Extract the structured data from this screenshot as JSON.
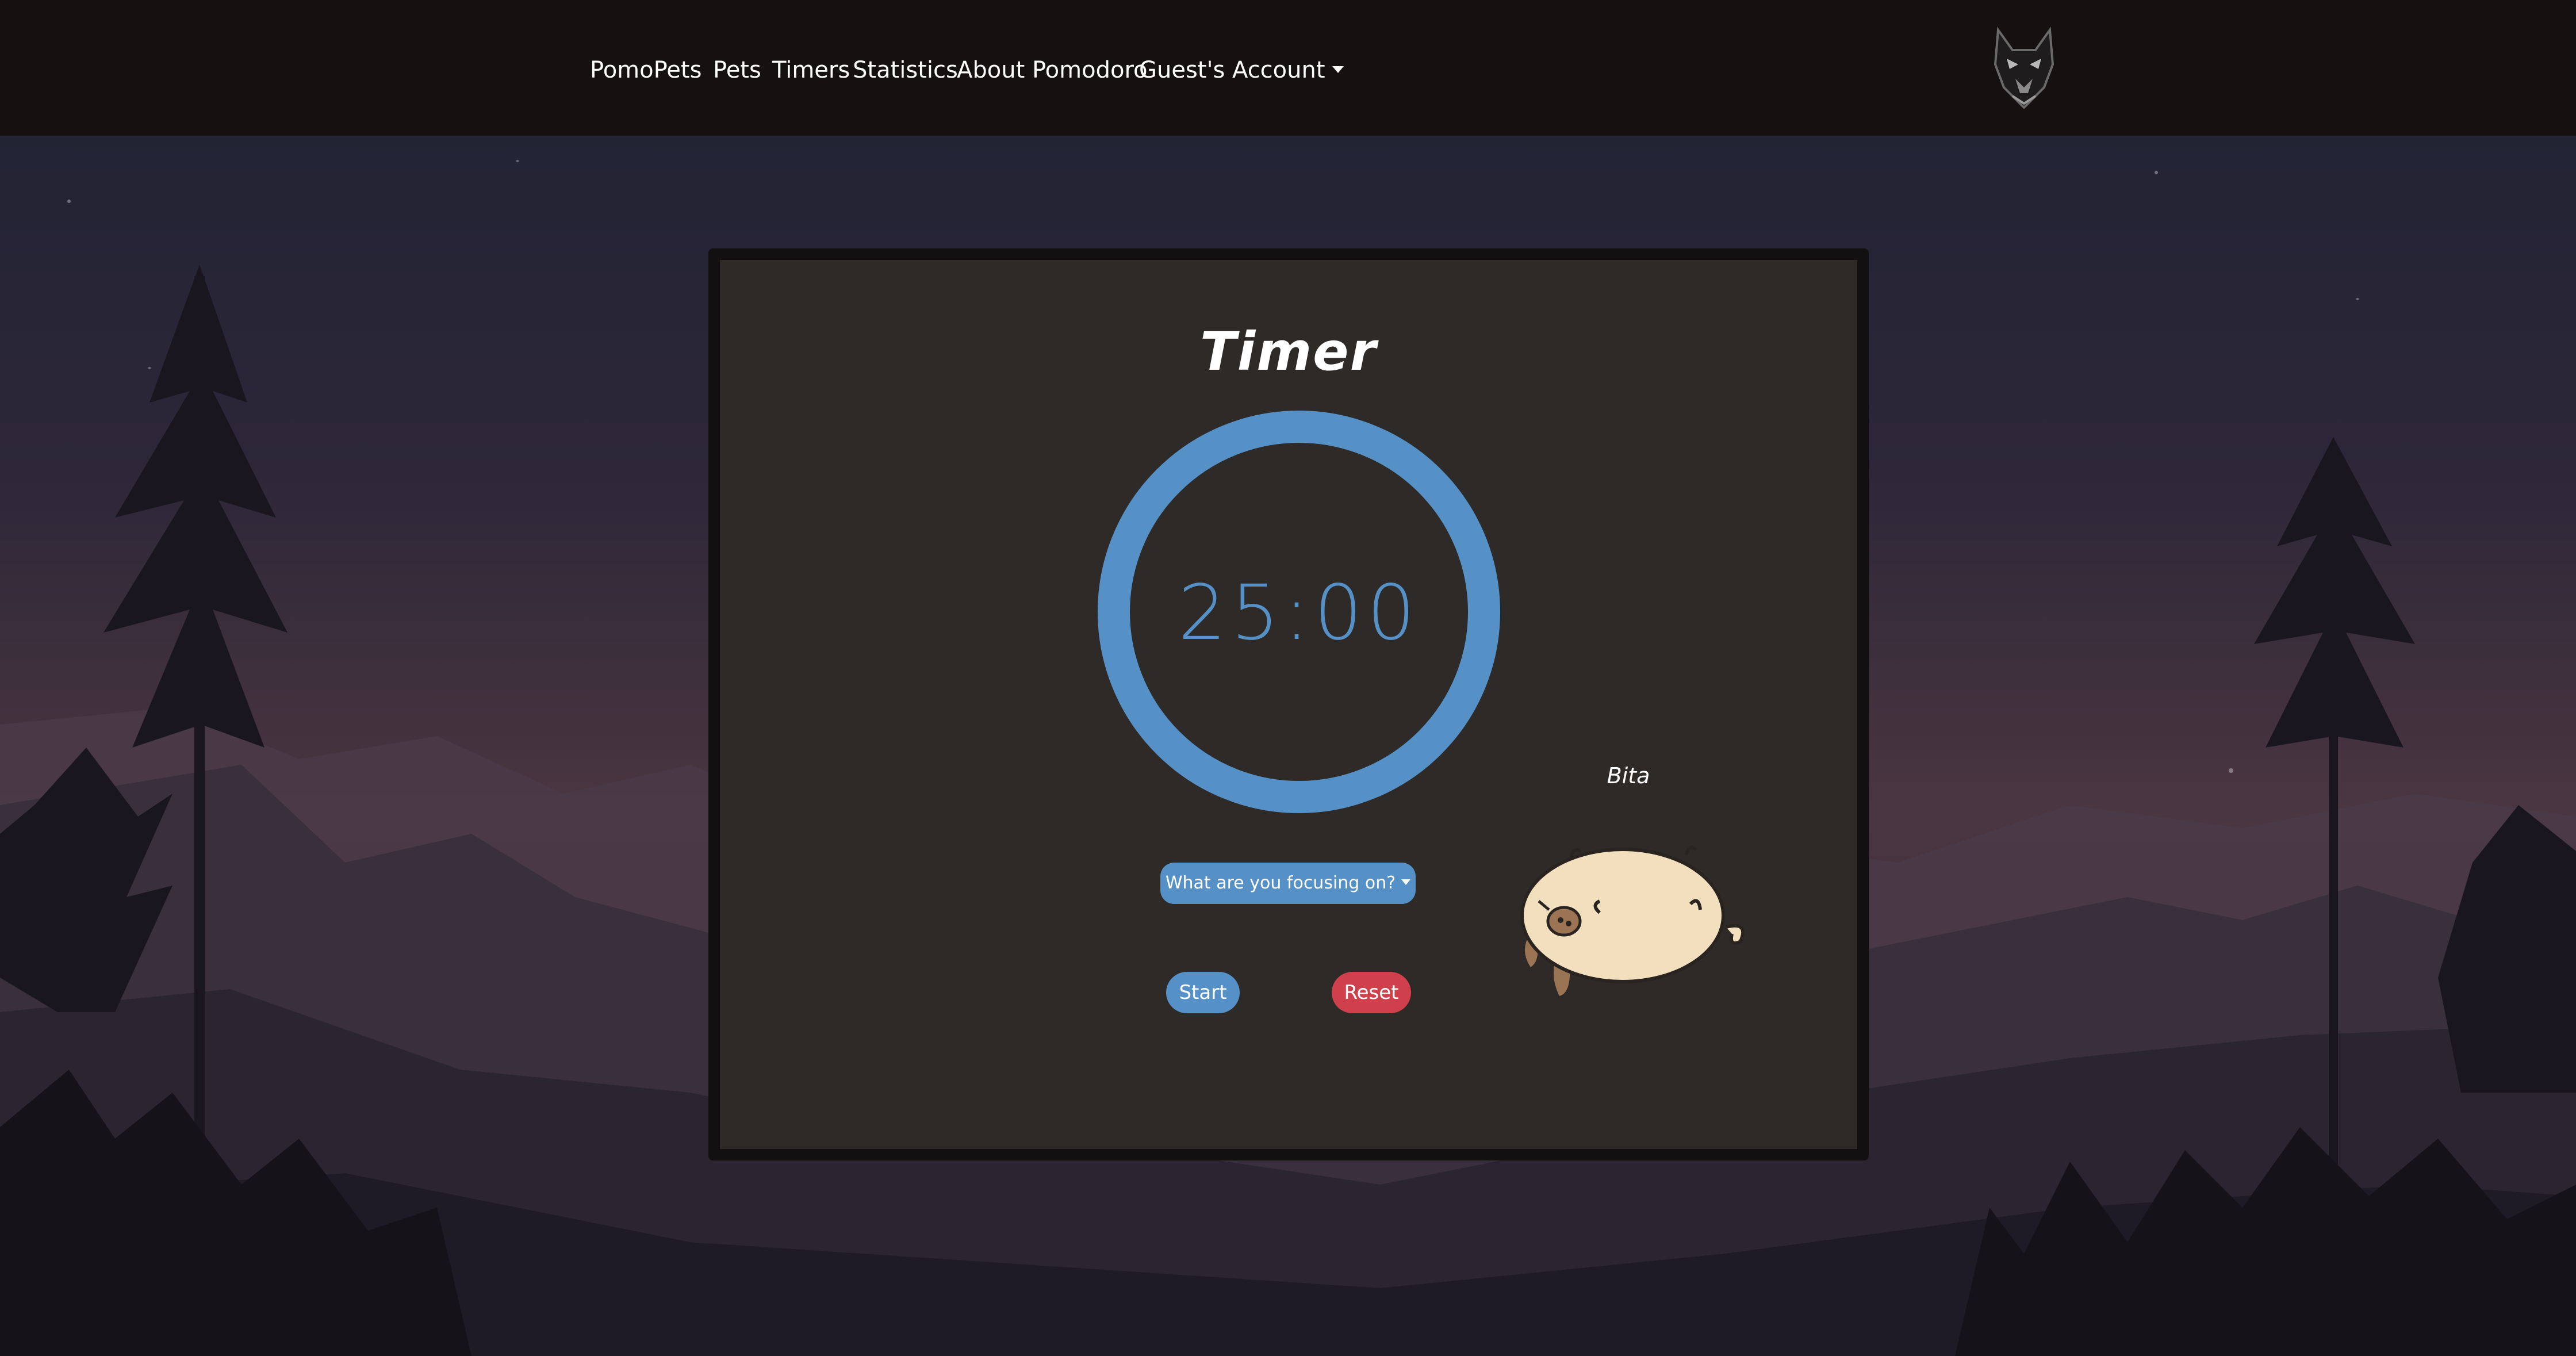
{
  "navbar": {
    "brand": "PomoPets",
    "links": [
      "Pets",
      "Timers",
      "Statistics",
      "About Pomodoro"
    ],
    "account_label": "Guest's Account",
    "logo_icon": "wolf-head-icon"
  },
  "timer": {
    "title": "Timer",
    "time": "25:00",
    "progress": 1.0,
    "ring_color": "#5591c7",
    "focus_placeholder": "What are you focusing on?",
    "start_label": "Start",
    "reset_label": "Reset"
  },
  "pet": {
    "name": "Bita",
    "sprite_icon": "pig-pet-icon"
  },
  "colors": {
    "accent": "#5591c7",
    "danger": "#d0404c",
    "card_bg": "#2e2a28",
    "navbar_bg": "#141110"
  }
}
